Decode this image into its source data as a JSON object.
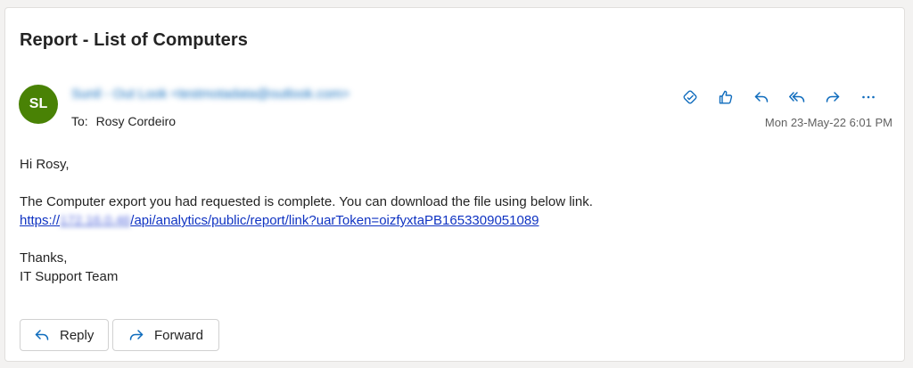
{
  "email": {
    "subject": "Report - List of Computers",
    "avatar_initials": "SL",
    "avatar_color": "#498205",
    "sender": "Sunil - Out Look <testmotadata@outlook.com>",
    "to_label": "To:",
    "recipient": "Rosy Cordeiro",
    "date": "Mon 23-May-22 6:01 PM",
    "body": {
      "greeting": "Hi Rosy,",
      "line1": "The Computer export you had requested is complete. You can download the file using below link.",
      "link_prefix": "https://",
      "link_host": "172.16.0.46",
      "link_path": "/api/analytics/public/report/link?uarToken=oizfyxtaPB1653309051089",
      "signoff": "Thanks,",
      "signature": "IT Support Team"
    }
  },
  "toolbar": {
    "icons": [
      "sensitivity-icon",
      "like-icon",
      "reply-icon",
      "reply-all-icon",
      "forward-icon",
      "more-icon"
    ],
    "accent": "#0f6cbd"
  },
  "buttons": {
    "reply_label": "Reply",
    "forward_label": "Forward"
  }
}
